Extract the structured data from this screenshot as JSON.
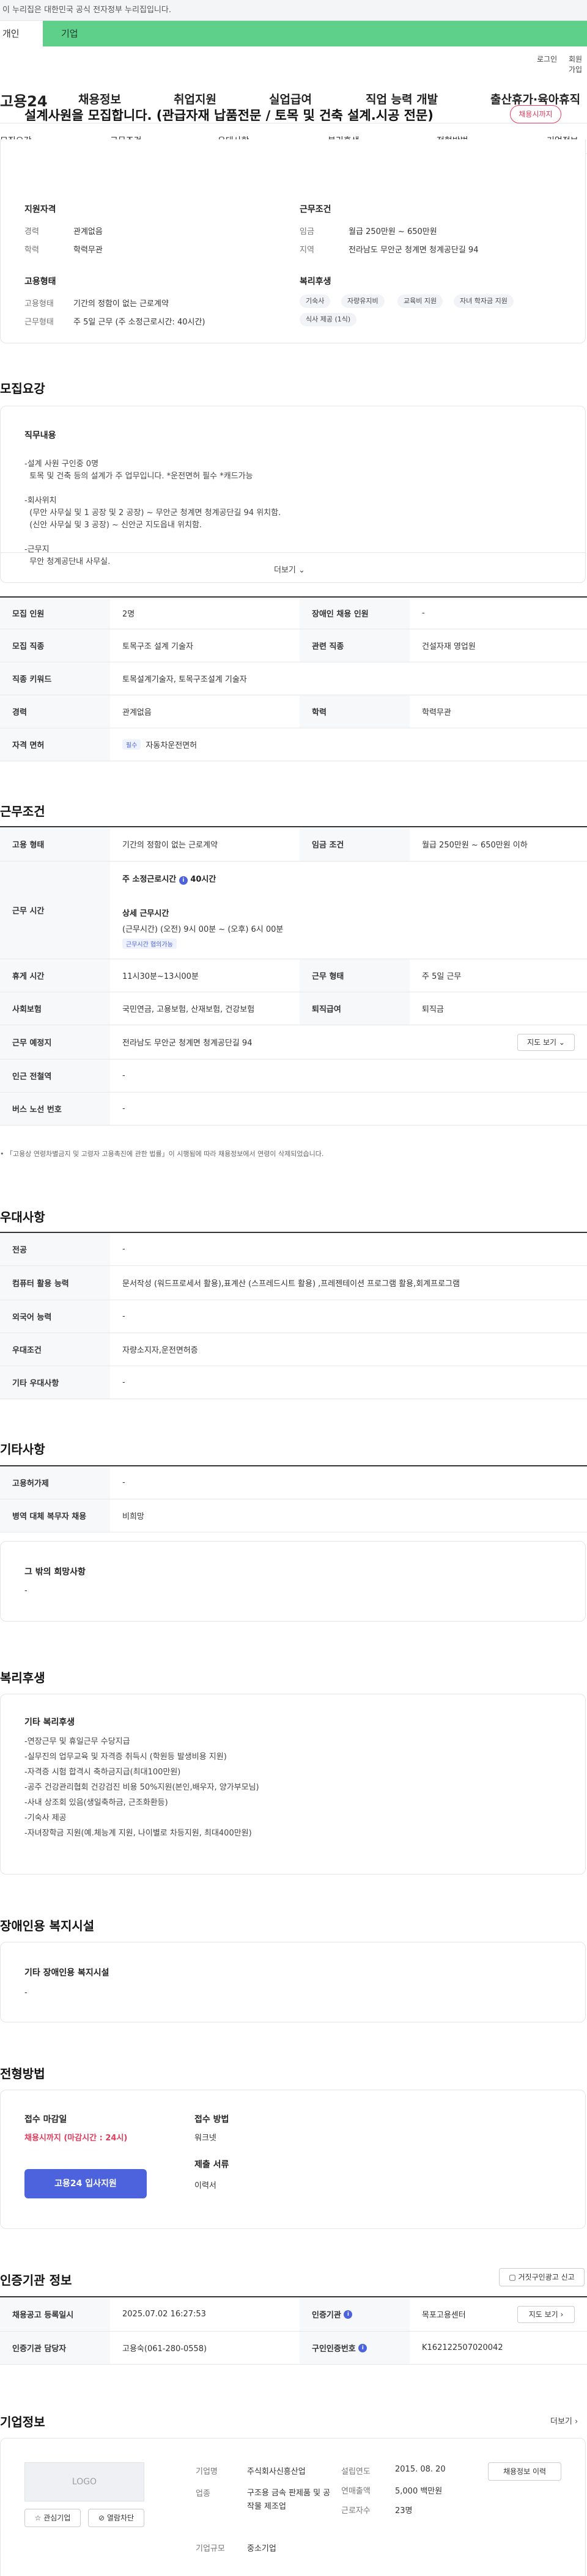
{
  "header": {
    "gov_notice": "이 누리집은 대한민국 공식 전자정부 누리집입니다.",
    "tab_person": "개인",
    "tab_company": "기업",
    "login": "로그인",
    "join": "회원가입",
    "logo": "고용24",
    "nav": [
      "채용정보",
      "취업지원",
      "실업급여",
      "직업 능력 개발",
      "출산휴가·육아휴직"
    ],
    "subnav": [
      "모집요강",
      "근무조건",
      "우대사항",
      "복리후생",
      "전형방법",
      "기업정보"
    ]
  },
  "job": {
    "title": "설계사원을 모집합니다. (관급자재 납품전문 / 토목 및 건축 설계.시공 전문)",
    "deadline_badge": "채용시까지",
    "qual": {
      "title": "지원자격",
      "career_label": "경력",
      "career": "관계없음",
      "edu_label": "학력",
      "edu": "학력무관"
    },
    "cond": {
      "title": "근무조건",
      "pay_label": "임금",
      "pay": "월급 250만원 ~ 650만원",
      "loc_label": "지역",
      "loc": "전라남도 무안군 청계면 청계공단길 94"
    },
    "emp": {
      "title": "고용형태",
      "type_label": "고용형태",
      "type": "기간의 정함이 없는 근로계약",
      "hours_label": "근무형태",
      "hours": "주 5일 근무 (주 소정근로시간: 40시간)"
    },
    "welfare": {
      "title": "복리후생",
      "chips": [
        "기숙사",
        "자량유지비",
        "교육비 지원",
        "자녀 학자금 지원",
        "식사 제공 (1식)"
      ]
    }
  },
  "req": {
    "section": "모집요강",
    "content_title": "직무내용",
    "lines": [
      "-설계 사원 구인중 0명",
      "  토목 및 건축 등의 설계가 주 업무입니다. *운전면허 필수 *캐드가능",
      "",
      "-회사위치",
      "  (무안 사무실 및 1 공장 및 2 공장) ~ 무안군 청계면 청계공단길 94 위치함.",
      "  (신안 사무실 및 3 공장) ~ 신안군 지도읍내 위치함.",
      "",
      "-근무지",
      "  무안 청계공단내 사무실."
    ],
    "more": "더보기",
    "rows": [
      {
        "l": "모집 인원",
        "v": "2명",
        "l2": "장애인 채용 인원",
        "v2": "-"
      },
      {
        "l": "모집 직종",
        "v": "토목구조 설계 기술자",
        "l2": "관련 직종",
        "v2": "건설자재 영업원"
      },
      {
        "l": "직종 키워드",
        "v": "토목설계기술자, 토목구조설계 기술자"
      },
      {
        "l": "경력",
        "v": "관계없음",
        "l2": "학력",
        "v2": "학력무관"
      },
      {
        "l": "자격 면허",
        "tag": "필수",
        "v": "자동차운전면허"
      }
    ]
  },
  "work": {
    "section": "근무조건",
    "rows": [
      {
        "l": "고용 형태",
        "v": "기간의 정함이 없는 근로계약",
        "l2": "임금 조건",
        "v2": "월급 250만원 ~ 650만원 이하"
      }
    ],
    "time_label": "근무 시간",
    "time_total": "주 소정근로시간",
    "time_hours": "40시간",
    "time_detail_title": "상세 근무시간",
    "time_detail": "(근무시간) (오전) 9시 00분 ~ (오후) 6시 00분",
    "time_tag": "근무시간 협의가능",
    "rows2": [
      {
        "l": "휴게 시간",
        "v": "11시30분~13시00분",
        "l2": "근무 형태",
        "v2": "주 5일 근무"
      },
      {
        "l": "사회보험",
        "v": "국민연금, 고용보험, 산재보험, 건강보험",
        "l2": "퇴직급여",
        "v2": "퇴직금"
      },
      {
        "l": "근무 예정지",
        "v": "전라남도 무안군 청계면 청계공단길 94",
        "btn": "지도 보기"
      },
      {
        "l": "인근 전철역",
        "v": "-"
      },
      {
        "l": "버스 노선 번호",
        "v": "-"
      }
    ],
    "note": "「고용상 연령차별금지 및 고령자 고용촉진에 관한 법률」이 시행됨에 따라 채용정보에서 연령이 삭제되었습니다."
  },
  "pref": {
    "section": "우대사항",
    "rows": [
      {
        "l": "전공",
        "v": "-"
      },
      {
        "l": "컴퓨터 활용 능력",
        "v": "문서작성 (워드프로세서 활용),표계산 (스프레드시트 활용) ,프레젠테이션 프로그램 활용,회계프로그램"
      },
      {
        "l": "외국어 능력",
        "v": "-"
      },
      {
        "l": "우대조건",
        "v": "자량소지자,운전면허증"
      },
      {
        "l": "기타 우대사항",
        "v": "-"
      }
    ]
  },
  "etc": {
    "section": "기타사항",
    "rows": [
      {
        "l": "고용허가제",
        "v": "-"
      },
      {
        "l": "병역 대체 복무자 채용",
        "v": "비희망"
      }
    ],
    "other_title": "그 밖의 희망사항",
    "other_val": "-"
  },
  "benefit": {
    "section": "복리후생",
    "title": "기타 복리후생",
    "lines": [
      "-연장근무 및 휴일근무 수당지급",
      "-실무진의 업무교육 및 자격증 취득시 (학원등 발생비용 지원)",
      "-자격증 시험 합격시 축하금지급(최대100만원)",
      "-공주 건강관리협회 건강검진 비용 50%지원(본인,배우자, 양가부모님)",
      "-사내 상조회 있음(생일축하금, 근조화환등)",
      "-기숙사 제공",
      "-자녀장학금 지원(예.체능계 지원, 나이별로 차등지원, 최대400만원)"
    ]
  },
  "disab": {
    "section": "장애인용 복지시설",
    "title": "기타 장애인용 복지시설",
    "val": "-"
  },
  "process": {
    "section": "전형방법",
    "deadline_title": "접수 마감일",
    "deadline": "채용시까지 (마감시간 : 24시)",
    "apply_btn": "고용24 입사지원",
    "method_title": "접수 방법",
    "method": "워크넷",
    "docs_title": "제출 서류",
    "docs": "이력서"
  },
  "agency": {
    "section": "인증기관 정보",
    "report_btn": "거짓구인광고 신고",
    "rows": [
      {
        "l": "채용공고 등록일시",
        "v": "2025.07.02 16:27:53",
        "l2": "인증기관",
        "v2": "목포고용센터",
        "btn": "지도 보기"
      },
      {
        "l": "인증기관 담당자",
        "v": "고용숙(061-280-0558)",
        "l2": "구인인증번호",
        "v2": "K162122507020042"
      }
    ]
  },
  "company": {
    "section": "기업정보",
    "more": "더보기",
    "logo": "LOGO",
    "fav_btn": "관심기업",
    "block_btn": "열람차단",
    "fields": [
      {
        "l": "기업명",
        "v": "주식회사신흥산업"
      },
      {
        "l": "업종",
        "v": "구조용 금속 판제품 및 공작물 제조업"
      },
      {
        "l": "기업규모",
        "v": "중소기업"
      }
    ],
    "fields2": [
      {
        "l": "설립연도",
        "v": "2015. 08. 20"
      },
      {
        "l": "연매출액",
        "v": "5,000 백만원"
      },
      {
        "l": "근로자수",
        "v": "23명"
      }
    ],
    "hist_btn": "채용정보 이력"
  }
}
